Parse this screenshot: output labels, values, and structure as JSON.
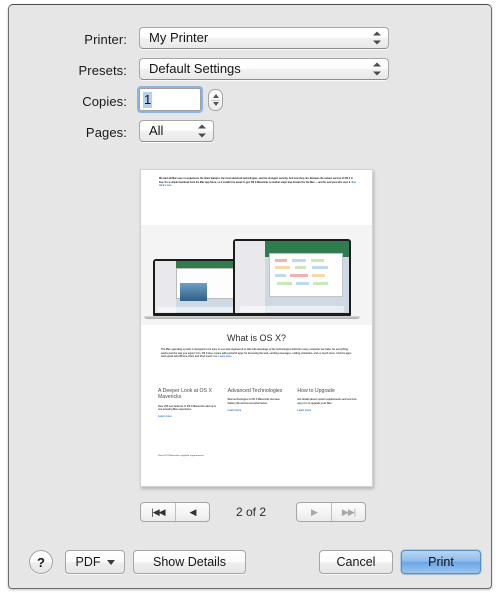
{
  "dialog": {
    "fields": [
      {
        "label": "Printer:",
        "value": "My Printer"
      },
      {
        "label": "Presets:",
        "value": "Default Settings"
      },
      {
        "label": "Copies:",
        "value": "1"
      },
      {
        "label": "Pages:",
        "value": "All"
      }
    ]
  },
  "preview": {
    "intro": "We want all Mac users to experience the latest features, the most advanced technologies, and the strongest security. And now they can. Because the newest version of OS X is free. It's a simple download from the Mac App Store, so it couldn't be easier to get. OS X Mavericks is another major leap forward for the Mac — and for everyone who uses it.",
    "intro_link": "See what's new",
    "headline": "What is OS X?",
    "subcopy": "The Mac operating system is designed to be easy to use and engineered to take full advantage of the technologies built into every computer we make. So everything works just the way you expect it to. OS X also comes with powerful apps for browsing the web, sending messages, setting reminders, and so much more. And the apps work great with iPhone, iPad, and iPod touch, too.",
    "subcopy_link": "Learn more",
    "columns": [
      {
        "title": "A Deeper Look at OS X Mavericks",
        "body": "Over 200 new features in OS X Mavericks add up to one amazing Mac experience.",
        "link": "Learn more"
      },
      {
        "title": "Advanced Technologies",
        "body": "New technologies in OS X Mavericks increase battery life and boost performance.",
        "link": "Learn more"
      },
      {
        "title": "How to Upgrade",
        "body": "Get details about system requirements and see how easy it is to upgrade your Mac.",
        "link": "Learn more"
      }
    ],
    "footnote": "View OS X Mavericks upgrade requirements."
  },
  "pager": {
    "first_label": "|◀◀",
    "prev_label": "◀",
    "indicator": "2 of 2",
    "next_label": "▶",
    "last_label": "▶▶|"
  },
  "buttons": {
    "help": "?",
    "pdf": "PDF",
    "show_details": "Show Details",
    "cancel": "Cancel",
    "print": "Print"
  },
  "colors": {
    "accent": "#6ba6e4",
    "selection": "#b4d0ee",
    "link": "#2a6fd0"
  }
}
